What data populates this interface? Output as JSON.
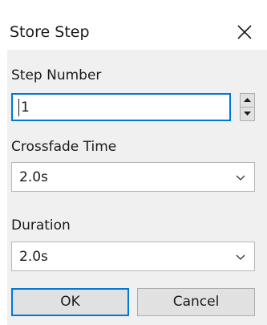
{
  "window": {
    "title": "Store Step"
  },
  "fields": {
    "step_number": {
      "label": "Step Number",
      "value": "1"
    },
    "crossfade_time": {
      "label": "Crossfade Time",
      "value": "2.0s"
    },
    "duration": {
      "label": "Duration",
      "value": "2.0s"
    }
  },
  "buttons": {
    "ok": "OK",
    "cancel": "Cancel"
  },
  "icons": {
    "close": "close-icon",
    "spin_up": "caret-up-icon",
    "spin_down": "caret-down-icon",
    "dropdown": "chevron-down-icon"
  },
  "colors": {
    "focus_accent": "#0078d7",
    "panel_bg": "#f0f0f0"
  }
}
